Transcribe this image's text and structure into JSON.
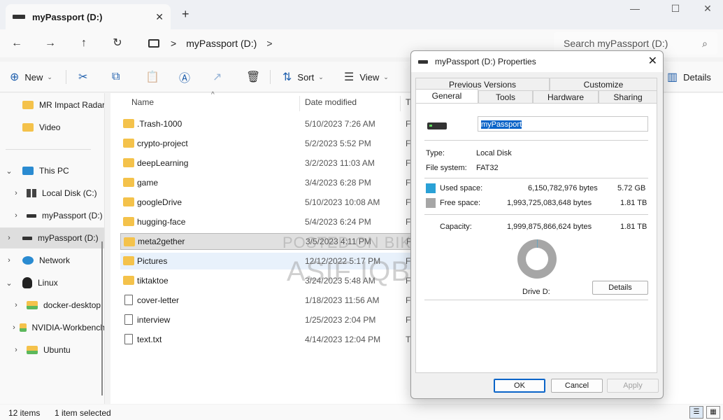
{
  "window": {
    "tab_title": "myPassport (D:)",
    "tab_close": "✕",
    "new_tab": "+",
    "minimize": "—",
    "maximize": "☐",
    "close": "✕"
  },
  "address": {
    "back": "←",
    "forward": "→",
    "up": "↑",
    "refresh": "↻",
    "breadcrumb_sep": ">",
    "location": "myPassport (D:)",
    "location_sep": ">",
    "search_placeholder": "Search myPassport (D:)",
    "search_icon": "⌕"
  },
  "toolbar": {
    "new_label": "New",
    "sort_label": "Sort",
    "view_label": "View",
    "details_label": "Details",
    "icons": {
      "new": "⊕",
      "cut": "✂",
      "copy": "⧉",
      "paste": "📋",
      "rename": "Ⓐ",
      "share": "↗",
      "delete": "🗑",
      "sort": "⇅",
      "view": "☰",
      "details": "▥"
    }
  },
  "sidebar": {
    "items": [
      {
        "label": "MR Impact Radar",
        "icon": "folder-icon"
      },
      {
        "label": "Video",
        "icon": "folder-icon"
      },
      {
        "label": "This PC",
        "icon": "pc-icon",
        "expanded": true
      },
      {
        "label": "Local Disk (C:)",
        "icon": "windows-drive-icon"
      },
      {
        "label": "myPassport (D:)",
        "icon": "drive-icon"
      },
      {
        "label": "myPassport (D:)",
        "icon": "drive-icon",
        "selected": true
      },
      {
        "label": "Network",
        "icon": "network-icon"
      },
      {
        "label": "Linux",
        "icon": "linux-icon",
        "expanded": true
      },
      {
        "label": "docker-desktop",
        "icon": "folder-icon"
      },
      {
        "label": "NVIDIA-Workbench",
        "icon": "folder-icon"
      },
      {
        "label": "Ubuntu",
        "icon": "folder-icon"
      }
    ],
    "chev_right": "›",
    "chev_down": "⌄"
  },
  "filelist": {
    "columns": {
      "name": "Name",
      "date": "Date modified",
      "type": "T"
    },
    "sort_indicator": "^",
    "rows": [
      {
        "name": ".Trash-1000",
        "date": "5/10/2023 7:26 AM",
        "type": "F",
        "kind": "folder"
      },
      {
        "name": "crypto-project",
        "date": "5/2/2023 5:52 PM",
        "type": "F",
        "kind": "folder"
      },
      {
        "name": "deepLearning",
        "date": "3/2/2023 11:03 AM",
        "type": "F",
        "kind": "folder"
      },
      {
        "name": "game",
        "date": "3/4/2023 6:28 PM",
        "type": "F",
        "kind": "folder"
      },
      {
        "name": "googleDrive",
        "date": "5/10/2023 10:08 AM",
        "type": "F",
        "kind": "folder"
      },
      {
        "name": "hugging-face",
        "date": "5/4/2023 6:24 PM",
        "type": "F",
        "kind": "folder"
      },
      {
        "name": "meta2gether",
        "date": "3/5/2023 4:11 PM",
        "type": "F",
        "kind": "folder",
        "selected": true
      },
      {
        "name": "Pictures",
        "date": "12/12/2022 5:17 PM",
        "type": "F",
        "kind": "folder",
        "hover": true
      },
      {
        "name": "tiktaktoe",
        "date": "3/24/2023 5:48 AM",
        "type": "F",
        "kind": "folder"
      },
      {
        "name": "cover-letter",
        "date": "1/18/2023 11:56 AM",
        "type": "F",
        "kind": "doc"
      },
      {
        "name": "interview",
        "date": "1/25/2023 2:04 PM",
        "type": "F",
        "kind": "doc"
      },
      {
        "name": "text.txt",
        "date": "4/14/2023 12:04 PM",
        "type": "T",
        "kind": "doc"
      }
    ]
  },
  "status": {
    "count": "12 items",
    "selection": "1 item selected",
    "details_view": "☰",
    "tiles_view": "▦"
  },
  "watermark": {
    "line1": "POSTED ON BIKROY",
    "line2": "ASIF IQBAL"
  },
  "dialog": {
    "title": "myPassport (D:) Properties",
    "close": "✕",
    "tabs_top": [
      "Previous Versions",
      "Customize"
    ],
    "tabs_bottom": [
      "General",
      "Tools",
      "Hardware",
      "Sharing"
    ],
    "drive_name": "myPassport",
    "type_label": "Type:",
    "type_value": "Local Disk",
    "fs_label": "File system:",
    "fs_value": "FAT32",
    "used_label": "Used space:",
    "used_bytes": "6,150,782,976 bytes",
    "used_size": "5.72 GB",
    "used_color": "#2aa1d6",
    "free_label": "Free space:",
    "free_bytes": "1,993,725,083,648 bytes",
    "free_size": "1.81 TB",
    "free_color": "#a6a6a6",
    "capacity_label": "Capacity:",
    "capacity_bytes": "1,999,875,866,624 bytes",
    "capacity_size": "1.81 TB",
    "used_fraction": 0.003,
    "drive_label": "Drive D:",
    "details_button": "Details",
    "ok_button": "OK",
    "cancel_button": "Cancel",
    "apply_button": "Apply"
  }
}
